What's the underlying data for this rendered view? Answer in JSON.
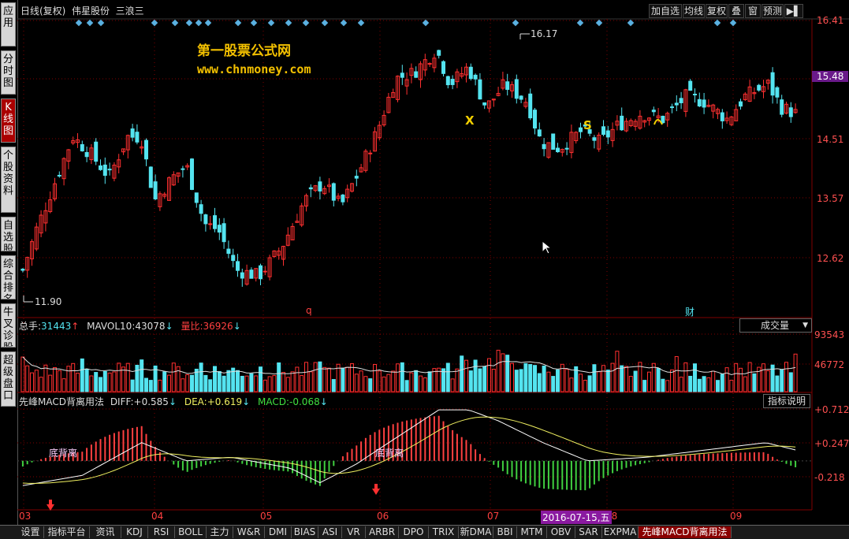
{
  "sidebar": {
    "tabs": [
      {
        "label": "应用",
        "active": false
      },
      {
        "label": "分时图",
        "active": false
      },
      {
        "label": "K线图",
        "active": true
      },
      {
        "label": "个股资料",
        "active": false
      },
      {
        "label": "自选股",
        "active": false
      },
      {
        "label": "综合排名",
        "active": false
      },
      {
        "label": "牛叉诊股",
        "active": false
      },
      {
        "label": "超级盘口",
        "active": false
      }
    ]
  },
  "header": {
    "title": "日线(复权)  伟星股份  三浪三",
    "buttons": [
      "加自选",
      "均线",
      "复权",
      "叠",
      "窗",
      "预测"
    ],
    "menu_icon": "arrow-bar-icon"
  },
  "watermark": {
    "line1": "第一股票公式网",
    "line2": "www.chnmoney.com"
  },
  "price_axis": {
    "ticks": [
      "16.41",
      "15.48",
      "14.51",
      "13.57",
      "12.62"
    ],
    "current": "15.48"
  },
  "annotations": {
    "high": "16.17",
    "low": "11.90",
    "marker_q": "q",
    "marker_cai": "财"
  },
  "volume_panel": {
    "label_total": "总手:",
    "total": "31443",
    "mavol_label": "MAVOL10:",
    "mavol": "43078",
    "ratio_label": "量比:",
    "ratio": "36926",
    "dropdown": "成交量",
    "ticks": [
      "93543",
      "46772"
    ]
  },
  "macd_panel": {
    "name": "先峰MACD背离用法",
    "diff_label": "DIFF:",
    "diff": "+0.585",
    "dea_label": "DEA:",
    "dea": "+0.619",
    "macd_label": "MACD:",
    "macd": "-0.068",
    "help_button": "指标说明",
    "ticks": [
      "+0.712",
      "+0.247",
      "-0.218"
    ],
    "text_a": "底背离",
    "text_b": "底背离"
  },
  "x_axis": {
    "months": [
      "03",
      "04",
      "05",
      "06",
      "07",
      "08",
      "09"
    ],
    "cursor_date": "2016-07-15,五"
  },
  "bottom_tabs": [
    "设置",
    "指标平台",
    "资讯",
    "KDJ",
    "RSI",
    "BOLL",
    "主力",
    "W&R",
    "DMI",
    "BIAS",
    "ASI",
    "VR",
    "ARBR",
    "DPO",
    "TRIX",
    "新DMA",
    "BBI",
    "MTM",
    "OBV",
    "SAR",
    "EXPMA",
    "先峰MACD背离用法"
  ],
  "active_bottom_tab": "先峰MACD背离用法",
  "chart_data": {
    "type": "candlestick",
    "price_range": [
      11.75,
      16.5
    ],
    "key_points": {
      "low": 11.9,
      "high": 16.17,
      "last": 15.0
    },
    "volume_range": [
      0,
      93543
    ],
    "macd_range": [
      -0.35,
      0.75
    ],
    "colors": {
      "up": "#ff3030",
      "down": "#54e4f0",
      "grid": "#800000",
      "diff": "#ffffff",
      "dea": "#f0f060"
    }
  }
}
